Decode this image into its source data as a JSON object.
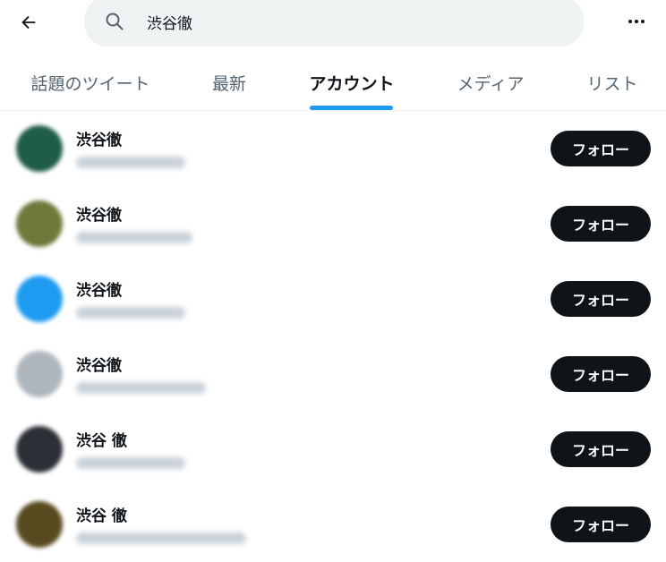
{
  "header": {
    "back_icon": "arrow-left-icon",
    "search_icon": "search-icon",
    "search_value": "渋谷徹",
    "more_icon": "more-horizontal-icon"
  },
  "tabs": [
    {
      "label": "話題のツイート",
      "active": false
    },
    {
      "label": "最新",
      "active": false
    },
    {
      "label": "アカウント",
      "active": true
    },
    {
      "label": "メディア",
      "active": false
    },
    {
      "label": "リスト",
      "active": false
    }
  ],
  "colors": {
    "accent": "#1d9bf0",
    "text": "#0f1419",
    "muted": "#536471",
    "button_bg": "#0f1419",
    "search_bg": "#eff3f4"
  },
  "accounts": [
    {
      "name": "渋谷徹",
      "follow_label": "フォロー",
      "avatar_color": "#1f5c4a"
    },
    {
      "name": "渋谷徹",
      "follow_label": "フォロー",
      "avatar_color": "#6d7a3a"
    },
    {
      "name": "渋谷徹",
      "follow_label": "フォロー",
      "avatar_color": "#1d9bf0"
    },
    {
      "name": "渋谷徹",
      "follow_label": "フォロー",
      "avatar_color": "#aeb6bd"
    },
    {
      "name": "渋谷 徹",
      "follow_label": "フォロー",
      "avatar_color": "#2b2f36"
    },
    {
      "name": "渋谷 徹",
      "follow_label": "フォロー",
      "avatar_color": "#5a4a20"
    }
  ]
}
